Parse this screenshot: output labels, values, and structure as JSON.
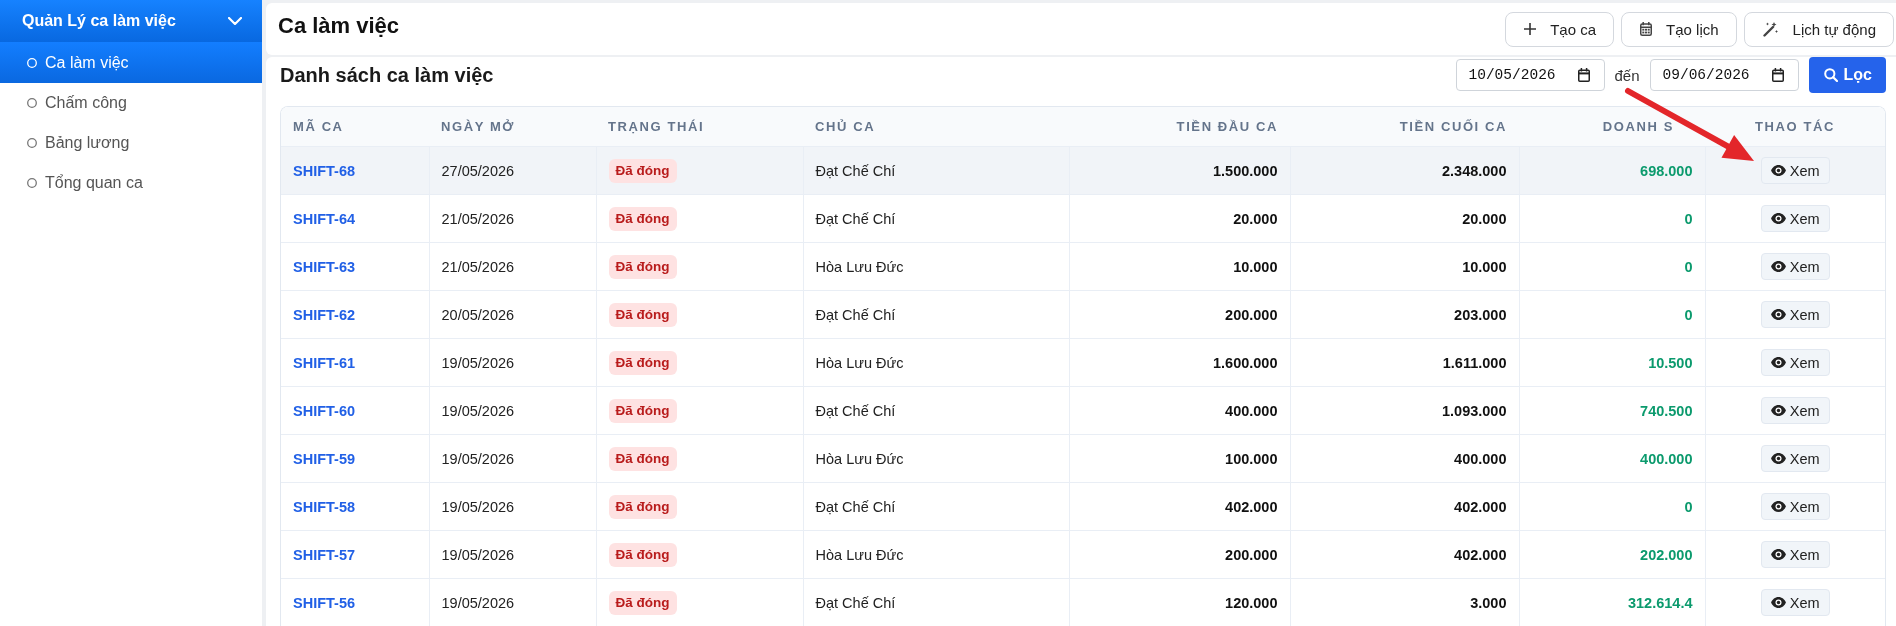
{
  "sidebar": {
    "group": {
      "label": "Quản Lý ca làm việc",
      "expanded": true
    },
    "items": [
      {
        "label": "Ca làm việc",
        "selected": true
      },
      {
        "label": "Chấm công",
        "selected": false
      },
      {
        "label": "Bảng lương",
        "selected": false
      },
      {
        "label": "Tổng quan ca",
        "selected": false
      }
    ]
  },
  "header": {
    "title": "Ca làm việc",
    "actions": [
      "Tạo ca",
      "Tạo lịch",
      "Lịch tự động"
    ]
  },
  "list": {
    "title": "Danh sách ca làm việc",
    "date_from": "10/05/2026",
    "date_separator": "đến",
    "date_to": "09/06/2026",
    "filter_button": "Lọc"
  },
  "table": {
    "columns": [
      "MÃ CA",
      "NGÀY MỞ",
      "TRẠNG THÁI",
      "CHỦ CA",
      "TIỀN ĐẦU CA",
      "TIỀN CUỐI CA",
      "DOANH S",
      "THAO TÁC"
    ],
    "rows": [
      {
        "code": "SHIFT-68",
        "opened": "27/05/2026",
        "status": "Đã đóng",
        "owner": "Đạt Chế Chí",
        "opening_cash": "1.500.000",
        "closing_cash": "2.348.000",
        "revenue": "698.000",
        "action": "Xem",
        "highlighted": true
      },
      {
        "code": "SHIFT-64",
        "opened": "21/05/2026",
        "status": "Đã đóng",
        "owner": "Đạt Chế Chí",
        "opening_cash": "20.000",
        "closing_cash": "20.000",
        "revenue": "0",
        "action": "Xem",
        "highlighted": false
      },
      {
        "code": "SHIFT-63",
        "opened": "21/05/2026",
        "status": "Đã đóng",
        "owner": "Hòa Lưu Đức",
        "opening_cash": "10.000",
        "closing_cash": "10.000",
        "revenue": "0",
        "action": "Xem",
        "highlighted": false
      },
      {
        "code": "SHIFT-62",
        "opened": "20/05/2026",
        "status": "Đã đóng",
        "owner": "Đạt Chế Chí",
        "opening_cash": "200.000",
        "closing_cash": "203.000",
        "revenue": "0",
        "action": "Xem",
        "highlighted": false
      },
      {
        "code": "SHIFT-61",
        "opened": "19/05/2026",
        "status": "Đã đóng",
        "owner": "Hòa Lưu Đức",
        "opening_cash": "1.600.000",
        "closing_cash": "1.611.000",
        "revenue": "10.500",
        "action": "Xem",
        "highlighted": false
      },
      {
        "code": "SHIFT-60",
        "opened": "19/05/2026",
        "status": "Đã đóng",
        "owner": "Đạt Chế Chí",
        "opening_cash": "400.000",
        "closing_cash": "1.093.000",
        "revenue": "740.500",
        "action": "Xem",
        "highlighted": false
      },
      {
        "code": "SHIFT-59",
        "opened": "19/05/2026",
        "status": "Đã đóng",
        "owner": "Hòa Lưu Đức",
        "opening_cash": "100.000",
        "closing_cash": "400.000",
        "revenue": "400.000",
        "action": "Xem",
        "highlighted": false
      },
      {
        "code": "SHIFT-58",
        "opened": "19/05/2026",
        "status": "Đã đóng",
        "owner": "Đạt Chế Chí",
        "opening_cash": "402.000",
        "closing_cash": "402.000",
        "revenue": "0",
        "action": "Xem",
        "highlighted": false
      },
      {
        "code": "SHIFT-57",
        "opened": "19/05/2026",
        "status": "Đã đóng",
        "owner": "Hòa Lưu Đức",
        "opening_cash": "200.000",
        "closing_cash": "402.000",
        "revenue": "202.000",
        "action": "Xem",
        "highlighted": false
      },
      {
        "code": "SHIFT-56",
        "opened": "19/05/2026",
        "status": "Đã đóng",
        "owner": "Đạt Chế Chí",
        "opening_cash": "120.000",
        "closing_cash": "3.000",
        "revenue": "312.614.4",
        "action": "Xem",
        "highlighted": false
      }
    ]
  },
  "annotations": [
    {
      "kind": "arrow"
    }
  ]
}
